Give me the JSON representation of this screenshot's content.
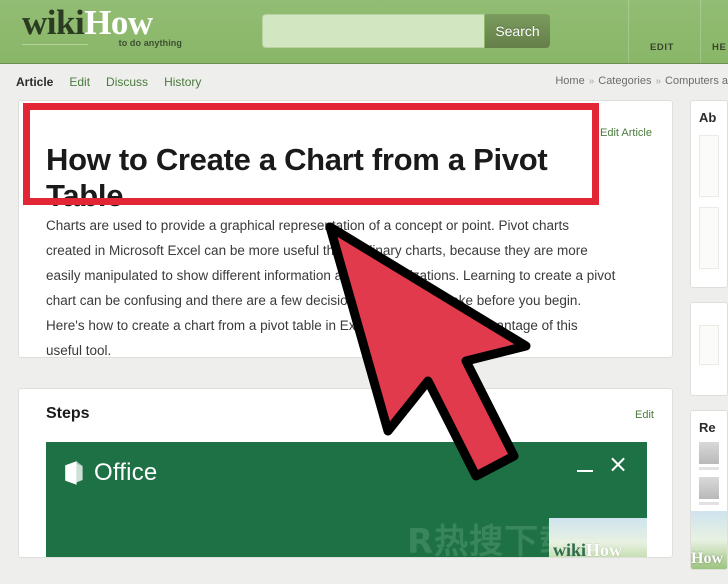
{
  "site": {
    "logo_primary": "wiki",
    "logo_secondary": "How",
    "tagline": "to do anything"
  },
  "search": {
    "value": "",
    "placeholder": "",
    "button_label": "Search"
  },
  "top_nav": [
    {
      "label": "EDIT",
      "name": "top-nav-edit"
    },
    {
      "label": "HE",
      "name": "top-nav-help"
    }
  ],
  "tabs": [
    {
      "label": "Article",
      "active": true
    },
    {
      "label": "Edit",
      "active": false
    },
    {
      "label": "Discuss",
      "active": false
    },
    {
      "label": "History",
      "active": false
    }
  ],
  "breadcrumb": {
    "items": [
      "Home",
      "Categories",
      "Computers a"
    ],
    "separator": "»"
  },
  "article": {
    "title": "How to Create a Chart from a Pivot Table",
    "edit_link": "Edit Article",
    "intro": "Charts are used to provide a graphical representation of a concept or point. Pivot charts created in Microsoft Excel can be more useful than ordinary charts, because they are more easily manipulated to show different information and summarizations. Learning to create a pivot chart can be confusing and there are a few decisions you need to make before you begin. Here's how to create a chart from a pivot table in Excel so you can take advantage of this useful tool."
  },
  "steps": {
    "heading": "Steps",
    "edit_link": "Edit"
  },
  "office_window": {
    "app_label": "Office",
    "minimize_label": "–",
    "close_label": "×",
    "title_bar_color": "#1e7145"
  },
  "watermark": {
    "text": "R热搜下载",
    "logo_primary": "wiki",
    "logo_secondary": "How"
  },
  "sidebar": {
    "about_title": "Ab",
    "related_title": "Re",
    "bottom_logo": "How"
  },
  "annotation": {
    "highlight_color": "#e32636",
    "cursor_fill": "#e03a4c",
    "cursor_stroke": "#000000"
  }
}
